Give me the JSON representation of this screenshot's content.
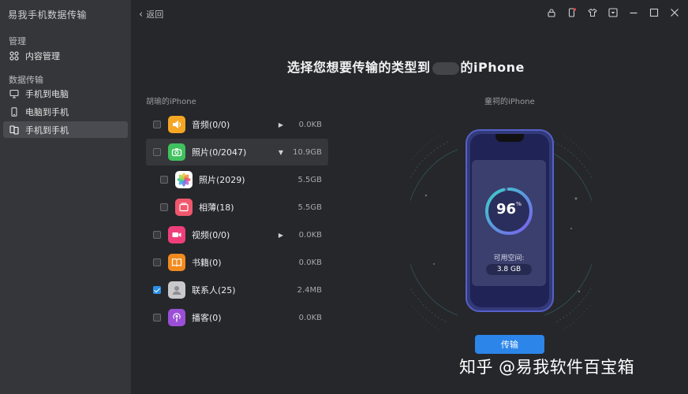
{
  "app": {
    "title": "易我手机数据传输"
  },
  "sidebar": {
    "section1": "管理",
    "item_manage": "内容管理",
    "section2": "数据传输",
    "item_phone_pc": "手机到电脑",
    "item_pc_phone": "电脑到手机",
    "item_phone_phone": "手机到手机"
  },
  "topbar": {
    "back_label": "返回"
  },
  "main": {
    "title_prefix": "选择您想要传输的类型到",
    "title_suffix": "的iPhone",
    "source_device": "胡瑜的iPhone",
    "target_device": "童祠的iPhone"
  },
  "rows": {
    "music": {
      "label": "音频(0/0)",
      "size": "0.0KB",
      "checked": false
    },
    "photos": {
      "label": "照片(0/2047)",
      "size": "10.9GB",
      "checked": false
    },
    "photos_sub": {
      "label": "照片(2029)",
      "size": "5.5GB",
      "checked": false
    },
    "albums": {
      "label": "相薄(18)",
      "size": "5.5GB",
      "checked": false
    },
    "video": {
      "label": "视频(0/0)",
      "size": "0.0KB",
      "checked": false
    },
    "books": {
      "label": "书籍(0)",
      "size": "0.0KB",
      "checked": false
    },
    "contacts": {
      "label": "联系人(25)",
      "size": "2.4MB",
      "checked": true
    },
    "podcasts": {
      "label": "播客(0)",
      "size": "0.0KB",
      "checked": false
    }
  },
  "storage": {
    "percent": "96",
    "percent_sign": "%",
    "progress": 0.96,
    "available_label": "可用空间:",
    "available_value": "3.8 GB"
  },
  "transfer_button": "传输",
  "watermark": "知乎 @易我软件百宝箱",
  "colors": {
    "accent": "#2c86ea",
    "ring_start": "#7c5cf0",
    "ring_end": "#3ad2c8"
  }
}
